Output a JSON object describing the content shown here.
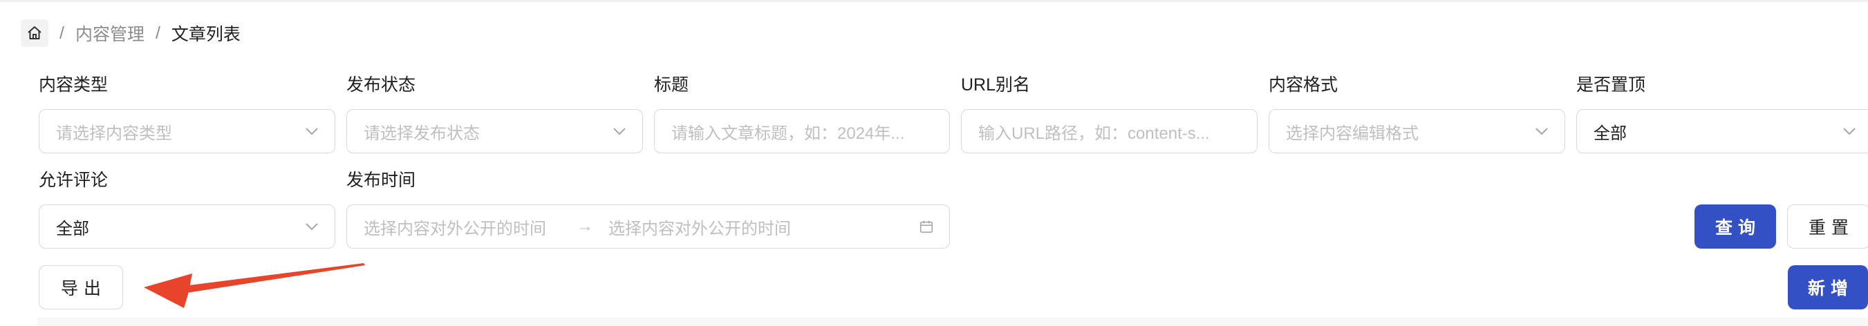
{
  "breadcrumb": {
    "icon": "home-icon",
    "separator": "/",
    "items": [
      "内容管理",
      "文章列表"
    ]
  },
  "filters": {
    "content_type": {
      "label": "内容类型",
      "placeholder": "请选择内容类型"
    },
    "publish_status": {
      "label": "发布状态",
      "placeholder": "请选择发布状态"
    },
    "title": {
      "label": "标题",
      "placeholder": "请输入文章标题，如：2024年..."
    },
    "url_alias": {
      "label": "URL别名",
      "placeholder": "输入URL路径，如：content-s..."
    },
    "content_format": {
      "label": "内容格式",
      "placeholder": "选择内容编辑格式"
    },
    "is_pinned": {
      "label": "是否置顶",
      "value": "全部"
    },
    "allow_comments": {
      "label": "允许评论",
      "value": "全部"
    },
    "publish_time": {
      "label": "发布时间",
      "start_placeholder": "选择内容对外公开的时间",
      "separator": "→",
      "end_placeholder": "选择内容对外公开的时间"
    }
  },
  "actions": {
    "query": "查询",
    "reset": "重置",
    "export": "导出",
    "add": "新增"
  },
  "annotation": {
    "arrow_color": "#e8442a"
  },
  "colors": {
    "primary": "#3350c4",
    "border": "#d9d9d9",
    "placeholder": "#bfbfbf"
  }
}
